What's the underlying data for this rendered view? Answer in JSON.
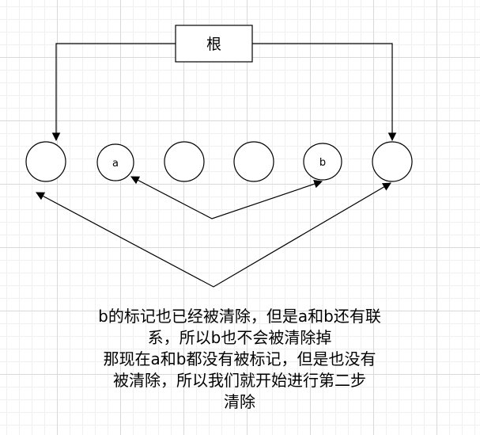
{
  "root": {
    "label": "根"
  },
  "objects": [
    {
      "id": "obj-1",
      "label": ""
    },
    {
      "id": "obj-a",
      "label": "a"
    },
    {
      "id": "obj-3",
      "label": ""
    },
    {
      "id": "obj-4",
      "label": ""
    },
    {
      "id": "obj-b",
      "label": "b"
    },
    {
      "id": "obj-6",
      "label": ""
    }
  ],
  "caption": {
    "lines": [
      "b的标记也已经被清除，但是a和b还有联",
      "系，所以b也不会被清除掉",
      "那现在a和b都没有被标记，但是也没有",
      "被清除，所以我们就开始进行第二步",
      "清除"
    ]
  }
}
